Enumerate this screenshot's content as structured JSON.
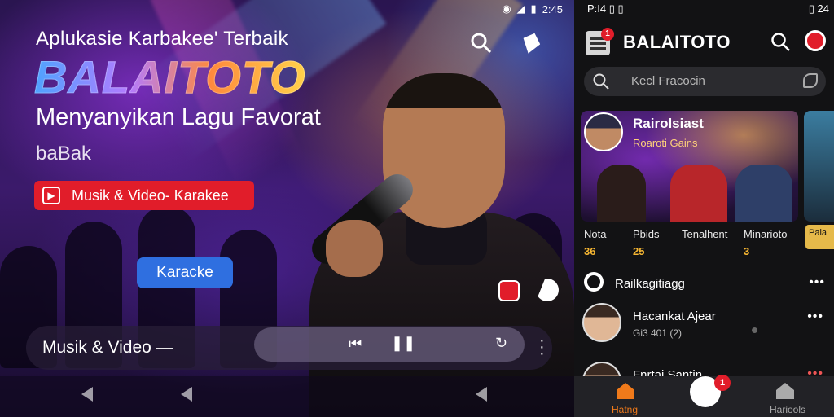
{
  "hero": {
    "status_time": "2:45",
    "tagline": "Aplukasie Karbakee' Terbaik",
    "brand": "BALAITOTO",
    "headline": "Menyanyikan Lagu Favorat",
    "subline": "baBak",
    "category_badge": "Musik & Video- Karakee",
    "cta_label": "Karacke",
    "player_title": "Musik & Video —"
  },
  "app": {
    "status_left": "P:I4 ▯  ▯",
    "status_right": "▯ 24",
    "title": "BALAITOTO",
    "menu_badge": "1",
    "search_placeholder": "Kecl Fracocin",
    "featured": {
      "name": "Rairolsiast",
      "subtitle": "Roaroti Gains"
    },
    "stats": [
      {
        "label": "Nota",
        "value": "36"
      },
      {
        "label": "Pbids",
        "value": "25"
      },
      {
        "label": "Tenalhent",
        "value": ""
      },
      {
        "label": "Minarioto",
        "value": "3"
      }
    ],
    "stat_tag": "Pala",
    "section_label": "Railkagitiagg",
    "list": [
      {
        "name": "Hacankat Ajear",
        "detail": "Gi3 401 (2)"
      },
      {
        "name": "Fnrtai Santin",
        "detail": ""
      }
    ],
    "nav": {
      "home_label": "Hatng",
      "center_badge": "1",
      "right_label": "Hariools"
    }
  }
}
